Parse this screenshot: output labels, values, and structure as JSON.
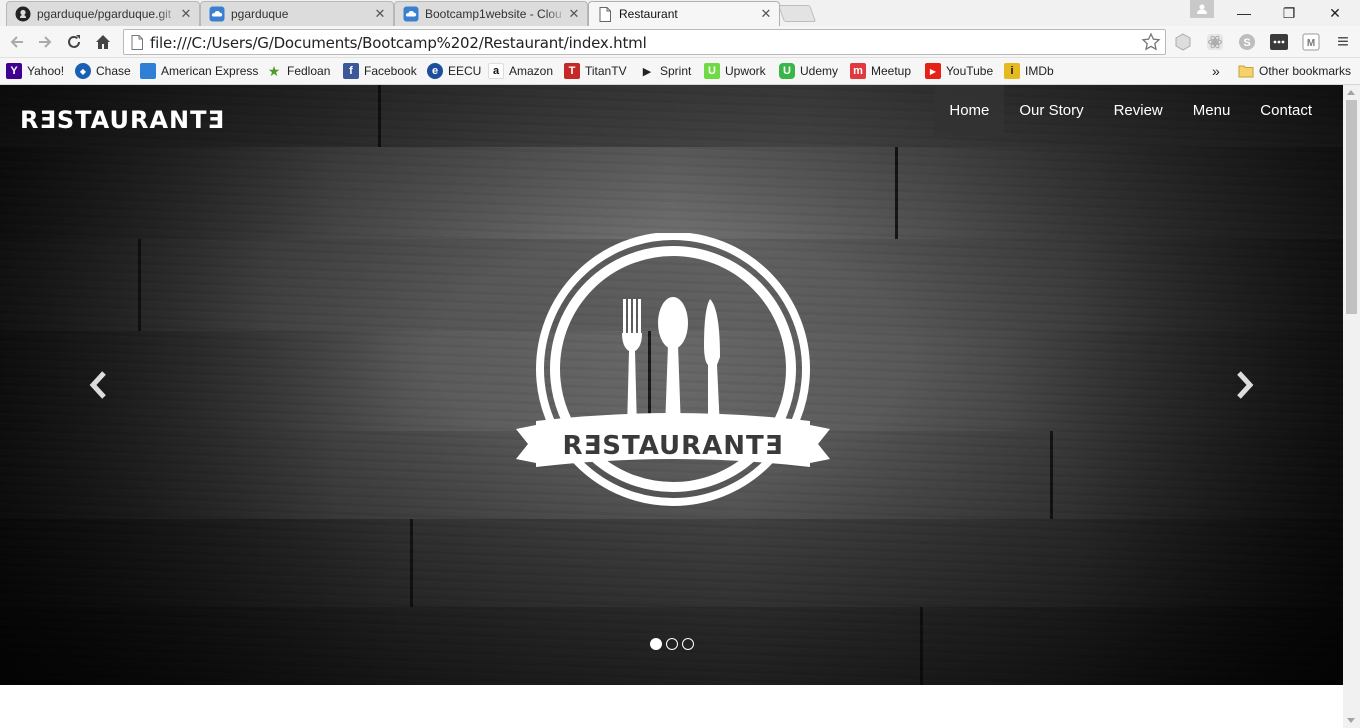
{
  "browser": {
    "tabs": [
      {
        "title": "pgarduque/pgarduque.git",
        "icon": "github-icon",
        "active": false
      },
      {
        "title": "pgarduque",
        "icon": "cloud9-icon",
        "active": false
      },
      {
        "title": "Bootcamp1website - Clou",
        "icon": "cloud9-icon",
        "active": false
      },
      {
        "title": "Restaurant",
        "icon": "page-icon",
        "active": true
      }
    ],
    "tab_close_glyph": "✕",
    "url": "file:///C:/Users/G/Documents/Bootcamp%202/Restaurant/index.html",
    "window_controls": {
      "minimize": "—",
      "maximize": "❐",
      "close": "✕"
    },
    "menu_glyph": "≡"
  },
  "bookmarks": {
    "items": [
      {
        "label": "Yahoo!",
        "icon": "yahoo-icon",
        "color": "#400090",
        "glyph": "Y"
      },
      {
        "label": "Chase",
        "icon": "chase-icon",
        "color": "#1a5fb4",
        "glyph": "◆"
      },
      {
        "label": "American Express",
        "icon": "amex-icon",
        "color": "#2f7fd6",
        "glyph": ""
      },
      {
        "label": "Fedloan",
        "icon": "fedloan-icon",
        "color": "#4d9a2a",
        "glyph": "★"
      },
      {
        "label": "Facebook",
        "icon": "facebook-icon",
        "color": "#3b5998",
        "glyph": "f"
      },
      {
        "label": "EECU",
        "icon": "eecu-icon",
        "color": "#1d4e9e",
        "glyph": "e"
      },
      {
        "label": "Amazon",
        "icon": "amazon-icon",
        "color": "#ffffff",
        "glyph": "a"
      },
      {
        "label": "TitanTV",
        "icon": "titantv-icon",
        "color": "#c62828",
        "glyph": "T"
      },
      {
        "label": "Sprint",
        "icon": "sprint-icon",
        "color": "#ffffff",
        "glyph": "▶"
      },
      {
        "label": "Upwork",
        "icon": "upwork-icon",
        "color": "#6fda44",
        "glyph": "U"
      },
      {
        "label": "Udemy",
        "icon": "udemy-icon",
        "color": "#3ab54a",
        "glyph": "U"
      },
      {
        "label": "Meetup",
        "icon": "meetup-icon",
        "color": "#e0393e",
        "glyph": "m"
      },
      {
        "label": "YouTube",
        "icon": "youtube-icon",
        "color": "#e62117",
        "glyph": "▶"
      },
      {
        "label": "IMDb",
        "icon": "imdb-icon",
        "color": "#e6b91e",
        "glyph": "i"
      }
    ],
    "overflow_glyph": "»",
    "other": "Other bookmarks"
  },
  "site": {
    "brand": "RƎSTAURANTƎ",
    "nav": [
      {
        "label": "Home",
        "active": true
      },
      {
        "label": "Our Story",
        "active": false
      },
      {
        "label": "Review",
        "active": false
      },
      {
        "label": "Menu",
        "active": false
      },
      {
        "label": "Contact",
        "active": false
      }
    ],
    "logo_text": "RƎSTAURANTƎ",
    "carousel": {
      "slides": 3,
      "active_index": 0,
      "prev_glyph": "‹",
      "next_glyph": "›"
    }
  }
}
